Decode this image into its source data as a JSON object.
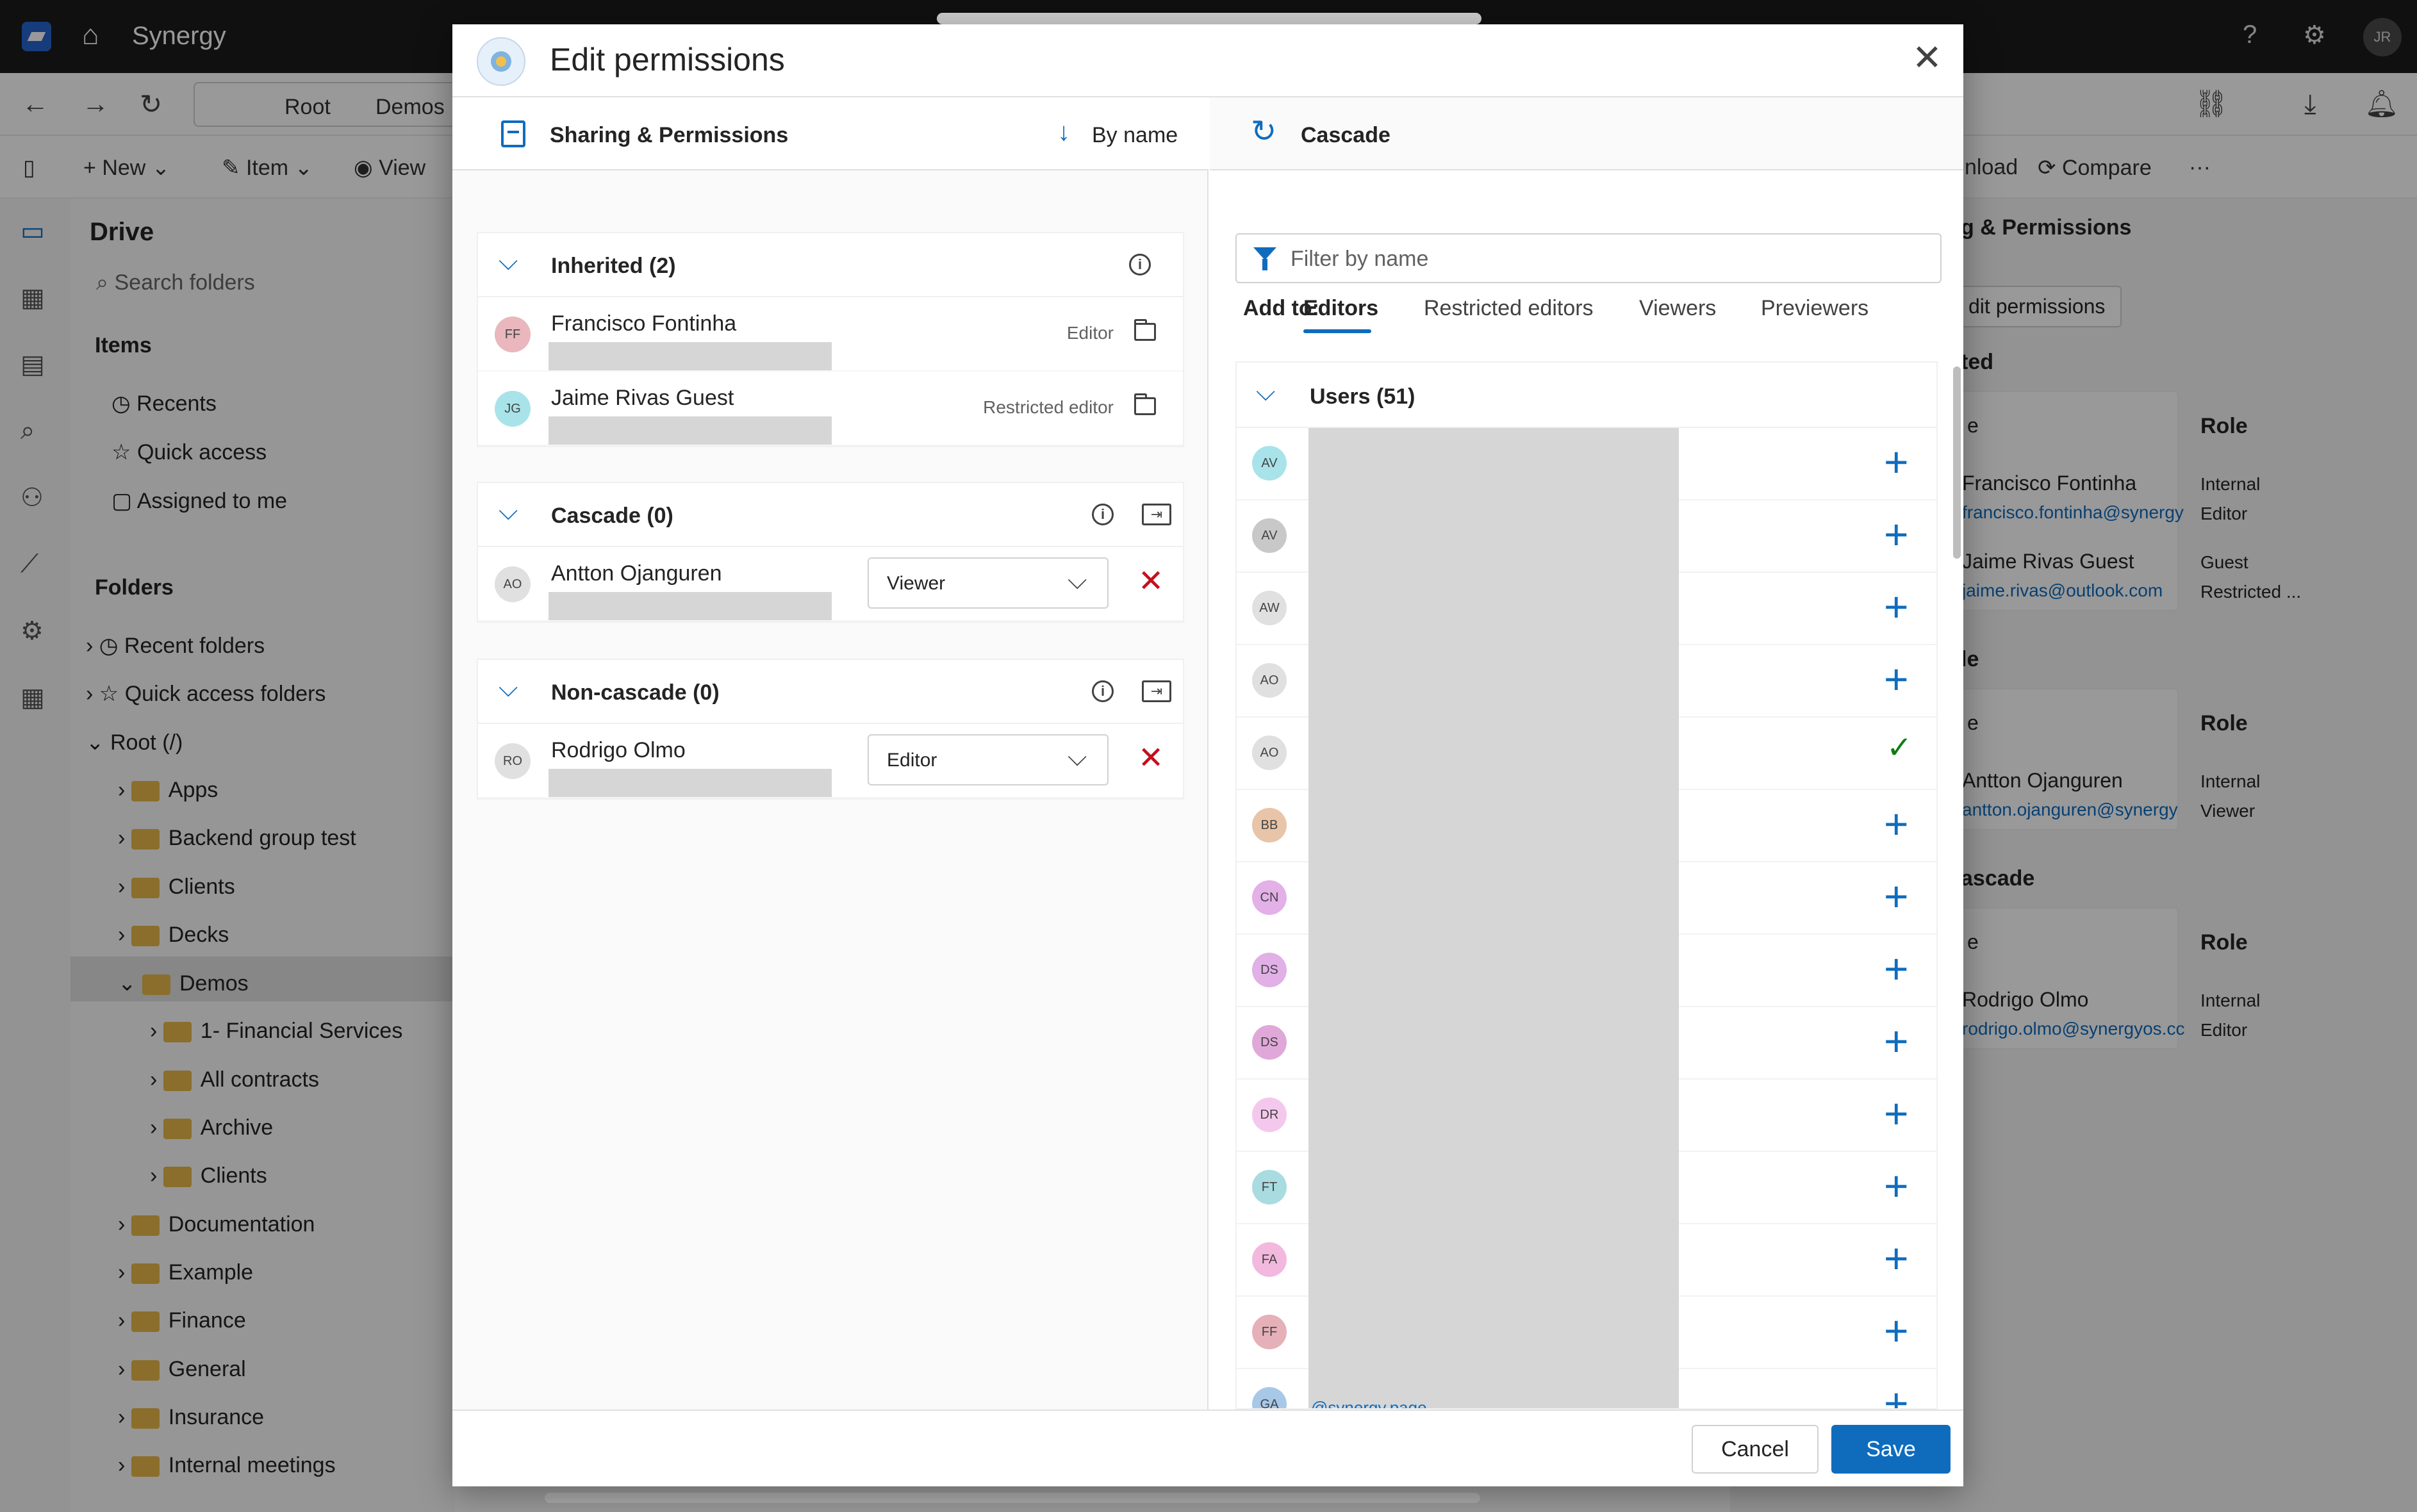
{
  "app": {
    "name": "Synergy",
    "user_initials": "JR",
    "breadcrumb": [
      "Root",
      "Demos"
    ],
    "toolbar": {
      "new": "New",
      "item": "Item",
      "view": "View",
      "download": "nload",
      "compare": "Compare",
      "more": "···"
    }
  },
  "sidebar": {
    "title": "Drive",
    "search_placeholder": "Search folders",
    "items_header": "Items",
    "items": [
      "Recents",
      "Quick access",
      "Assigned to me"
    ],
    "folders_header": "Folders",
    "folders": [
      {
        "label": "Recent folders",
        "level": 0
      },
      {
        "label": "Quick access folders",
        "level": 0
      },
      {
        "label": "Root (/)",
        "level": 0
      },
      {
        "label": "Apps",
        "level": 1
      },
      {
        "label": "Backend group test",
        "level": 1
      },
      {
        "label": "Clients",
        "level": 1
      },
      {
        "label": "Decks",
        "level": 1
      },
      {
        "label": "Demos",
        "level": 1
      },
      {
        "label": "1- Financial Services",
        "level": 2
      },
      {
        "label": "All contracts",
        "level": 2
      },
      {
        "label": "Archive",
        "level": 2
      },
      {
        "label": "Clients",
        "level": 2
      },
      {
        "label": "Documentation",
        "level": 1
      },
      {
        "label": "Example",
        "level": 1
      },
      {
        "label": "Finance",
        "level": 1
      },
      {
        "label": "General",
        "level": 1
      },
      {
        "label": "Insurance",
        "level": 1
      },
      {
        "label": "Internal meetings",
        "level": 1
      }
    ]
  },
  "right_panel": {
    "header": "g & Permissions",
    "edit_button": "dit permissions",
    "sections": [
      {
        "title": "ted",
        "role_header": "Role",
        "col_header": "e",
        "rows": [
          {
            "name": "Francisco Fontinha",
            "email": "francisco.fontinha@synergy",
            "type": "Internal",
            "role": "Editor"
          },
          {
            "name": "Jaime Rivas Guest",
            "email": "jaime.rivas@outlook.com",
            "type": "Guest",
            "role": "Restricted ..."
          }
        ]
      },
      {
        "title": "le",
        "role_header": "Role",
        "col_header": "e",
        "rows": [
          {
            "name": "Antton Ojanguren",
            "email": "antton.ojanguren@synergy",
            "type": "Internal",
            "role": "Viewer"
          }
        ]
      },
      {
        "title": "ascade",
        "role_header": "Role",
        "col_header": "e",
        "rows": [
          {
            "name": "Rodrigo Olmo",
            "email": "rodrigo.olmo@synergyos.cc",
            "type": "Internal",
            "role": "Editor"
          }
        ]
      }
    ]
  },
  "modal": {
    "title": "Edit permissions",
    "left_header": "Sharing & Permissions",
    "sort_label": "By name",
    "right_header": "Cascade",
    "inherited": {
      "title": "Inherited (2)",
      "rows": [
        {
          "initials": "FF",
          "name": "Francisco Fontinha",
          "role": "Editor",
          "color": "#e9b7bd"
        },
        {
          "initials": "JG",
          "name": "Jaime Rivas Guest",
          "role": "Restricted editor",
          "color": "#a9e3ea"
        }
      ]
    },
    "cascade": {
      "title": "Cascade (0)",
      "rows": [
        {
          "initials": "AO",
          "name": "Antton Ojanguren",
          "role": "Viewer",
          "color": "#e0e0e0"
        }
      ]
    },
    "non_cascade": {
      "title": "Non-cascade (0)",
      "rows": [
        {
          "initials": "RO",
          "name": "Rodrigo Olmo",
          "role": "Editor",
          "color": "#e0e0e0"
        }
      ]
    },
    "filter_placeholder": "Filter by name",
    "add_to_label": "Add to:",
    "tabs": [
      "Editors",
      "Restricted editors",
      "Viewers",
      "Previewers"
    ],
    "active_tab": "Editors",
    "users_title": "Users (51)",
    "users": [
      {
        "initials": "AV",
        "color": "#a9e3ea",
        "added": false
      },
      {
        "initials": "AV",
        "color": "#c8c8c8",
        "added": false
      },
      {
        "initials": "AW",
        "color": "#e0e0e0",
        "added": false
      },
      {
        "initials": "AO",
        "color": "#e0e0e0",
        "added": false
      },
      {
        "initials": "AO",
        "color": "#e0e0e0",
        "added": true
      },
      {
        "initials": "BB",
        "color": "#e8c4a8",
        "added": false
      },
      {
        "initials": "CN",
        "color": "#e3b0e8",
        "added": false
      },
      {
        "initials": "DS",
        "color": "#e0b0e6",
        "added": false
      },
      {
        "initials": "DS",
        "color": "#e0a8d8",
        "added": false
      },
      {
        "initials": "DR",
        "color": "#f4c8ec",
        "added": false
      },
      {
        "initials": "FT",
        "color": "#a8dce0",
        "added": false
      },
      {
        "initials": "FA",
        "color": "#f2b8de",
        "added": false
      },
      {
        "initials": "FF",
        "color": "#e6b0b8",
        "added": false
      },
      {
        "initials": "GA",
        "color": "#a8c8e8",
        "added": false
      }
    ],
    "email_peek": "@synergy.page",
    "cancel": "Cancel",
    "save": "Save"
  }
}
